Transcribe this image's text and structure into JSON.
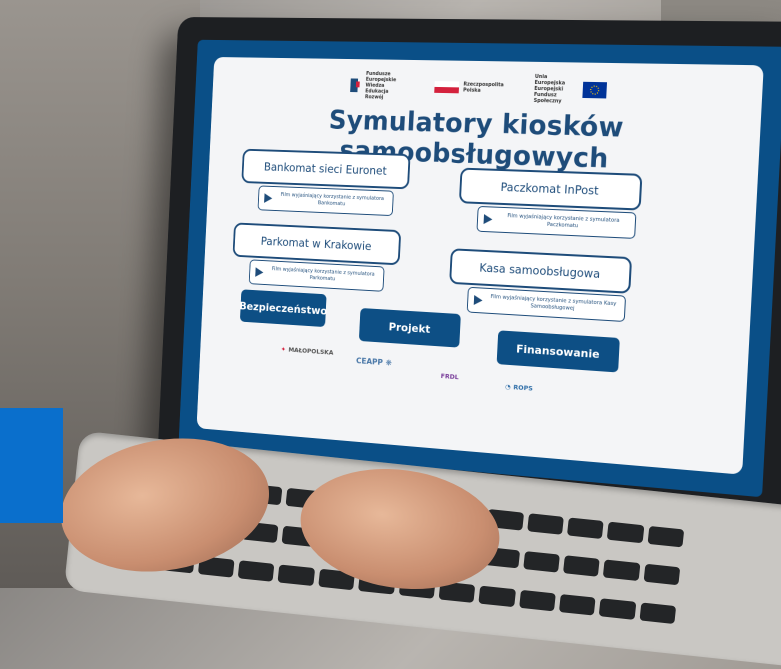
{
  "logos": [
    {
      "text": "Fundusze Europejskie Wiedza Edukacja Rozwój",
      "icon": "eu-funds-icon",
      "color": "#1e4c7a"
    },
    {
      "text": "Rzeczpospolita Polska",
      "icon": "polish-flag-icon",
      "color": "#d4213d"
    },
    {
      "text": "Unia Europejska Europejski Fundusz Społeczny",
      "icon": "eu-flag-icon",
      "color": "#003399"
    }
  ],
  "title": "Symulatory kiosków samoobsługowych",
  "kiosks": [
    {
      "label": "Bankomat sieci Euronet",
      "film": "Film wyjaśniający korzystanie z symulatora Bankomatu"
    },
    {
      "label": "Paczkomat InPost",
      "film": "Film wyjaśniający korzystanie z symulatora Paczkomatu"
    },
    {
      "label": "Parkomat w Krakowie",
      "film": "Film wyjaśniający korzystanie z symulatora Parkomatu"
    },
    {
      "label": "Kasa samoobsługowa",
      "film": "Film wyjaśniający korzystanie z symulatora Kasy Samoobsługowej"
    }
  ],
  "buttons": {
    "security": "Bezpieczeństwo",
    "project": "Projekt",
    "financing": "Finansowanie"
  },
  "partners": [
    "MAŁOPOLSKA",
    "CEAPP",
    "FRDL",
    "ROPS"
  ],
  "colors": {
    "primary": "#1e4c7a",
    "screen_frame": "#0a4f87",
    "accent_tile": "#0a6fcc"
  }
}
